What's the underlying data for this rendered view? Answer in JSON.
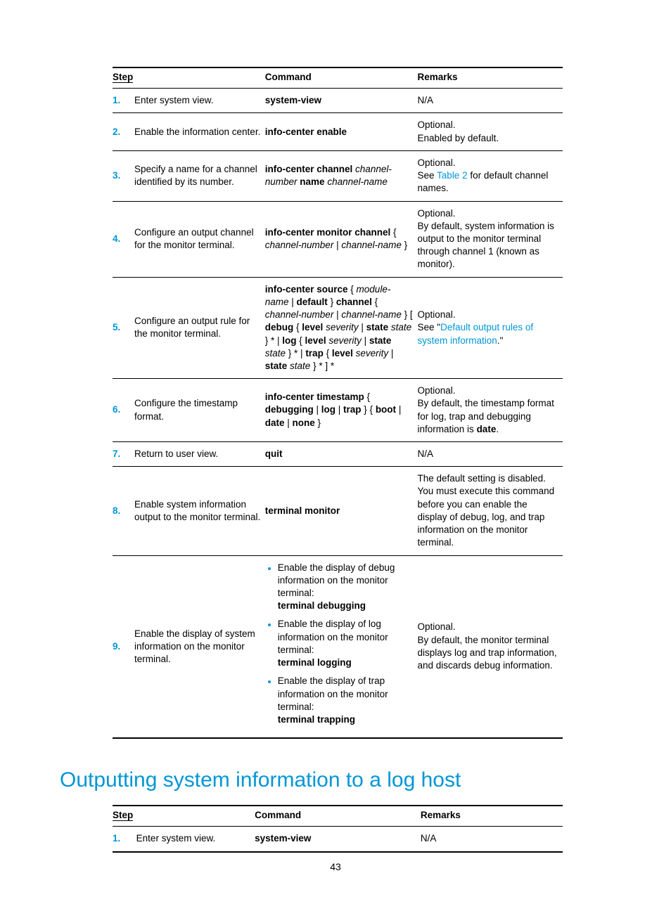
{
  "page_number": "43",
  "table1": {
    "headers": {
      "step": "Step",
      "command": "Command",
      "remarks": "Remarks"
    },
    "rows": [
      {
        "num": "1.",
        "step": "Enter system view.",
        "command_html": "<b>system-view</b>",
        "remarks_html": "N/A"
      },
      {
        "num": "2.",
        "step": "Enable the information center.",
        "command_html": "<b>info-center enable</b>",
        "remarks_html": "Optional.<br>Enabled by default."
      },
      {
        "num": "3.",
        "step": "Specify a name for a channel identified by its number.",
        "command_html": "<b>info-center channel</b> <i>channel-number</i> <b>name</b> <i>channel-name</i>",
        "remarks_html": "Optional.<br>See <span class=\"link\">Table 2</span> for default channel names."
      },
      {
        "num": "4.",
        "step": "Configure an output channel for the monitor terminal.",
        "command_html": "<b>info-center monitor channel</b> { <i>channel-number</i> | <i>channel-name</i> }",
        "remarks_html": "Optional.<br>By default, system information is output to the monitor terminal through channel 1 (known as monitor)."
      },
      {
        "num": "5.",
        "step": "Configure an output rule for the monitor terminal.",
        "command_html": "<b>info-center source</b> { <i>module-name</i> | <b>default</b> } <b>channel</b> { <i>channel-number</i> | <i>channel-name</i> } [ <b>debug</b> { <b>level</b> <i>severity</i> | <b>state</b> <i>state</i> } * | <b>log</b> { <b>level</b> <i>severity</i> | <b>state</b> <i>state</i> } * | <b>trap</b> { <b>level</b> <i>severity</i> | <b>state</b> <i>state</i> } * ] *",
        "remarks_html": "Optional.<br>See \"<span class=\"link\">Default output rules of system information</span>.\""
      },
      {
        "num": "6.",
        "step": "Configure the timestamp format.",
        "command_html": "<b>info-center timestamp</b> { <b>debugging</b> | <b>log</b> | <b>trap</b> } { <b>boot</b> | <b>date</b> | <b>none</b> }",
        "remarks_html": "Optional.<br>By default, the timestamp format for log, trap and debugging information is <b>date</b>."
      },
      {
        "num": "7.",
        "step": "Return to user view.",
        "command_html": "<b>quit</b>",
        "remarks_html": "N/A"
      },
      {
        "num": "8.",
        "step": "Enable system information output to the monitor terminal.",
        "command_html": "<b>terminal monitor</b>",
        "remarks_html": "The default setting is disabled.<br>You must execute this command before you can enable the display of debug, log, and trap information on the monitor terminal."
      },
      {
        "num": "9.",
        "step": "Enable the display of system information on the monitor terminal.",
        "command_html": "<ul class=\"cmdlist\"><li>Enable the display of debug information on the monitor terminal:<br><b>terminal debugging</b></li><li>Enable the display of log information on the monitor terminal:<br><b>terminal logging</b></li><li>Enable the display of trap information on the monitor terminal:<br><b>terminal trapping</b></li></ul>",
        "remarks_html": "Optional.<br>By default, the monitor terminal displays log and trap information, and discards debug information."
      }
    ]
  },
  "section_heading": "Outputting system information to a log host",
  "table2": {
    "headers": {
      "step": "Step",
      "command": "Command",
      "remarks": "Remarks"
    },
    "rows": [
      {
        "num": "1.",
        "step": "Enter system view.",
        "command_html": "<b>system-view</b>",
        "remarks_html": "N/A"
      }
    ]
  }
}
